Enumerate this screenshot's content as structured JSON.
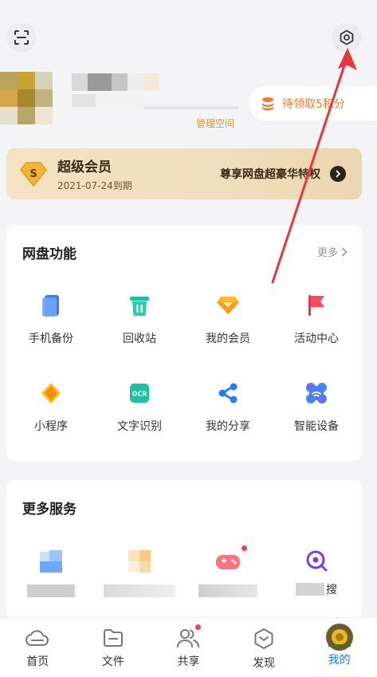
{
  "header": {
    "scan_icon": "scan-icon",
    "settings_icon": "settings-icon",
    "quota_label": "管理空间",
    "points_text": "待领取5积分"
  },
  "vip": {
    "title": "超级会员",
    "expiry": "2021-07-24到期",
    "promo": "尊享网盘超豪华特权"
  },
  "features": {
    "title": "网盘功能",
    "more": "更多",
    "items": [
      {
        "label": "手机备份",
        "icon": "phone-backup-icon"
      },
      {
        "label": "回收站",
        "icon": "trash-icon"
      },
      {
        "label": "我的会员",
        "icon": "diamond-icon"
      },
      {
        "label": "活动中心",
        "icon": "flag-icon"
      },
      {
        "label": "小程序",
        "icon": "mini-program-icon"
      },
      {
        "label": "文字识别",
        "icon": "ocr-icon"
      },
      {
        "label": "我的分享",
        "icon": "share-icon"
      },
      {
        "label": "智能设备",
        "icon": "smart-device-icon"
      }
    ]
  },
  "services": {
    "title": "更多服务",
    "items": [
      {
        "label": "",
        "icon": "folder-icon"
      },
      {
        "label": "",
        "icon": "service-icon"
      },
      {
        "label": "",
        "icon": "game-icon"
      },
      {
        "label": "搜",
        "icon": "search-icon"
      }
    ]
  },
  "tabbar": {
    "items": [
      {
        "label": "首页",
        "icon": "cloud-icon",
        "active": false
      },
      {
        "label": "文件",
        "icon": "file-icon",
        "active": false
      },
      {
        "label": "共享",
        "icon": "people-icon",
        "active": false
      },
      {
        "label": "发现",
        "icon": "discover-icon",
        "active": false
      },
      {
        "label": "我的",
        "icon": "avatar-icon",
        "active": true
      }
    ]
  },
  "colors": {
    "accent": "#1e7cf0",
    "points": "#f07a2e",
    "arrow": "#e8373a"
  }
}
